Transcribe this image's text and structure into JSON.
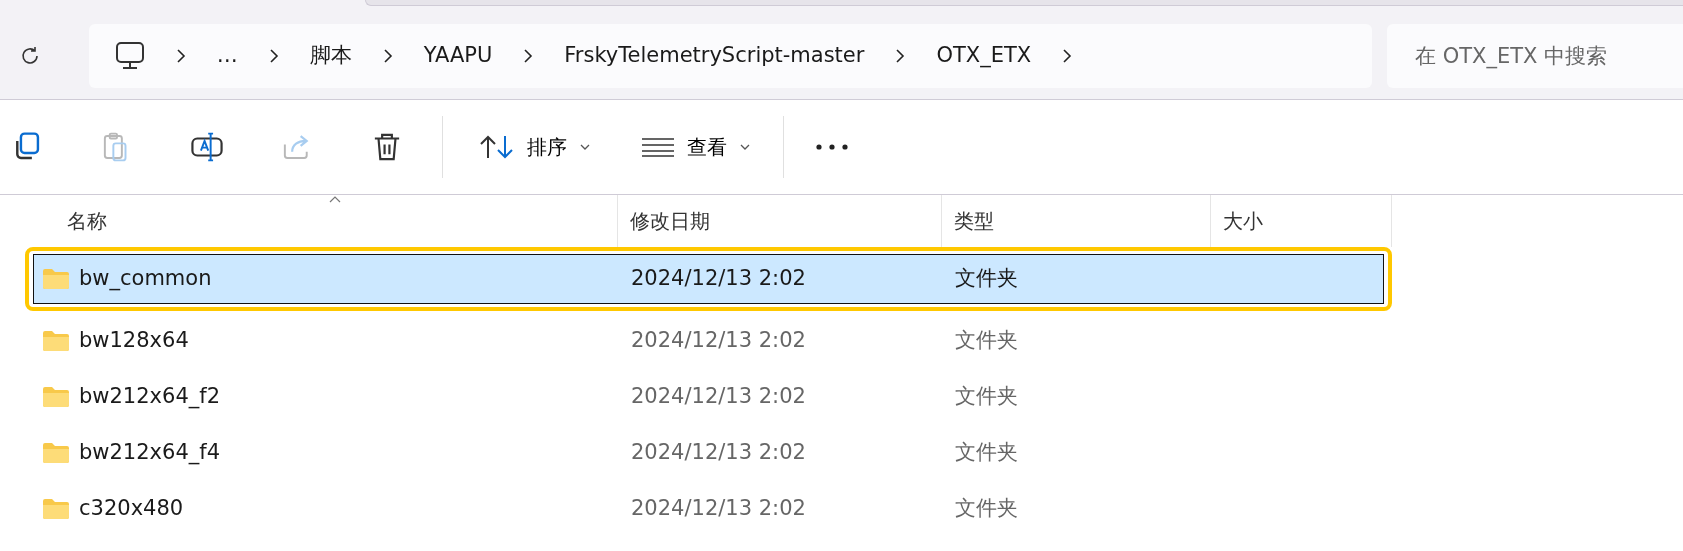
{
  "address_bar": {
    "crumbs": [
      "…",
      "脚本",
      "YAAPU",
      "FrskyTelemetryScript-master",
      "OTX_ETX"
    ]
  },
  "search": {
    "placeholder": "在 OTX_ETX 中搜索"
  },
  "toolbar": {
    "buttons": [
      {
        "kind": "copy",
        "disabled": false
      },
      {
        "kind": "paste",
        "disabled": true
      },
      {
        "kind": "rename",
        "disabled": false
      },
      {
        "kind": "share",
        "disabled": true
      },
      {
        "kind": "delete",
        "disabled": false
      }
    ],
    "sort": "排序",
    "view": "查看"
  },
  "table": {
    "columns": [
      "名称",
      "修改日期",
      "类型",
      "大小"
    ],
    "rows": [
      {
        "name": "bw_common",
        "modified": "2024/12/13 2:02",
        "type": "文件夹",
        "selected": true,
        "highlighted": true
      },
      {
        "name": "bw128x64",
        "modified": "2024/12/13 2:02",
        "type": "文件夹",
        "selected": false,
        "highlighted": false
      },
      {
        "name": "bw212x64_f2",
        "modified": "2024/12/13 2:02",
        "type": "文件夹",
        "selected": false,
        "highlighted": false
      },
      {
        "name": "bw212x64_f4",
        "modified": "2024/12/13 2:02",
        "type": "文件夹",
        "selected": false,
        "highlighted": false
      },
      {
        "name": "c320x480",
        "modified": "2024/12/13 2:02",
        "type": "文件夹",
        "selected": false,
        "highlighted": false
      }
    ]
  }
}
